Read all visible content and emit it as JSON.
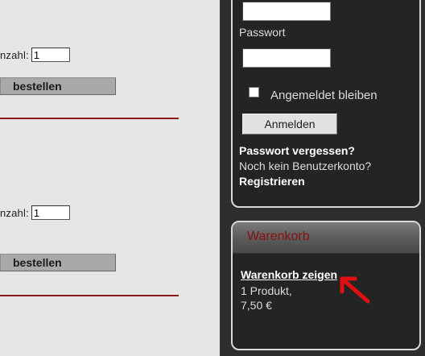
{
  "products": [
    {
      "quantity_label": "nzahl:",
      "quantity_value": "1",
      "order_label": "bestellen"
    },
    {
      "quantity_label": "nzahl:",
      "quantity_value": "1",
      "order_label": "bestellen"
    }
  ],
  "login": {
    "password_label": "Passwort",
    "remember_label": "Angemeldet bleiben",
    "login_button": "Anmelden",
    "forgot_password": "Passwort vergessen?",
    "no_account": "Noch kein Benutzerkonto?",
    "register": "Registrieren"
  },
  "cart": {
    "title": "Warenkorb",
    "show_link": "Warenkorb zeigen",
    "item_count": "1 Produkt,",
    "total": "7,50 €"
  },
  "colors": {
    "accent_red": "#8b1a1a",
    "sidebar_bg": "#2e2e2e",
    "arrow": "#e01010"
  },
  "icons": {
    "pointer": "red-arrow-icon"
  }
}
